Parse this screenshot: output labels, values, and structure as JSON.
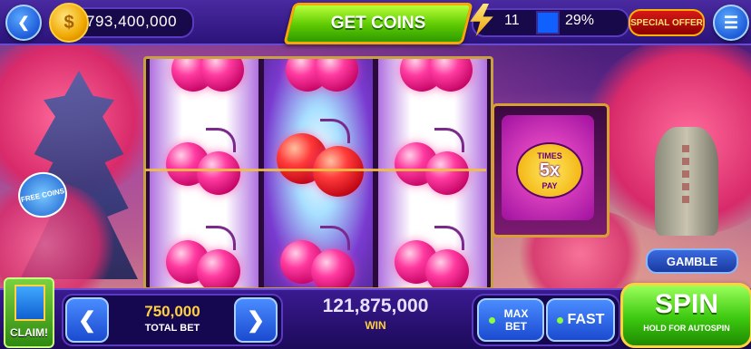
{
  "top_bar": {
    "back_icon": "chevron-left-icon",
    "coin_icon": "coin-icon",
    "coin_balance": "793,400,000",
    "get_coins_label": "GET COINS",
    "level_icon": "lightning-bolt-icon",
    "level": "11",
    "xp_progress": "29%",
    "special_offer_label": "SPECIAL OFFER",
    "menu_icon": "hamburger-menu-icon"
  },
  "reels": {
    "symbols": [
      [
        "pink-cherries",
        "pink-cherries",
        "pink-cherries"
      ],
      [
        "pink-cherries",
        "red-cherries",
        "pink-cherries"
      ],
      [
        "pink-cherries",
        "pink-cherries",
        "pink-cherries"
      ]
    ],
    "multiplier_top": "TIMES",
    "multiplier_value": "5x",
    "multiplier_bottom": "PAY"
  },
  "side": {
    "free_coins_label": "FREE COINS",
    "gamble_label": "GAMBLE"
  },
  "bottom_bar": {
    "claim_label": "CLAIM!",
    "total_bet_value": "750,000",
    "total_bet_label": "TOTAL BET",
    "win_value": "121,875,000",
    "win_label": "WIN",
    "max_bet_label": "MAX BET",
    "fast_label": "FAST",
    "spin_label": "SPIN",
    "spin_sublabel": "HOLD FOR AUTOSPIN"
  }
}
